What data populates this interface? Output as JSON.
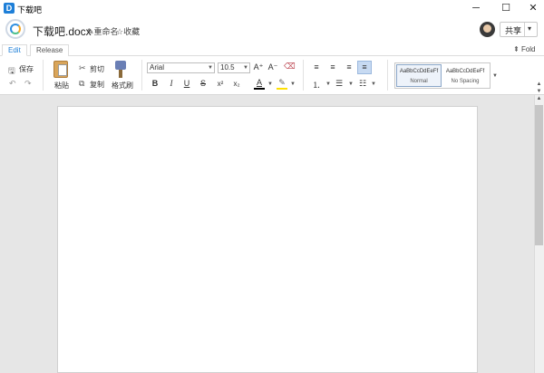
{
  "window": {
    "title": "下载吧",
    "app_icon_letter": "D",
    "minimize_glyph": "─",
    "maximize_glyph": "☐",
    "close_glyph": "✕"
  },
  "document": {
    "name": "下载吧.docx",
    "rename_label": "重命名",
    "favorite_label": "收藏",
    "share_label": "共享"
  },
  "tabs": [
    {
      "label": "Edit",
      "active": true
    },
    {
      "label": "Release",
      "active": false
    }
  ],
  "fold_label": "Fold",
  "ribbon": {
    "save_label": "保存",
    "paste_label": "粘贴",
    "cut_label": "剪切",
    "copy_label": "复制",
    "format_painter_label": "格式刷",
    "font_family": "Arial",
    "font_size": "10.5",
    "bold_glyph": "B",
    "italic_glyph": "I",
    "underline_glyph": "U",
    "strike_glyph": "S",
    "superscript_glyph": "x²",
    "subscript_glyph": "x₂",
    "font_color_glyph": "A",
    "grow_font_glyph": "A⁺",
    "shrink_font_glyph": "A⁻",
    "styles": [
      {
        "preview": "AaBbCcDdEeFf",
        "name": "Normal",
        "selected": true
      },
      {
        "preview": "AaBbCcDdEeFf",
        "name": "No Spacing",
        "selected": false
      }
    ]
  },
  "colors": {
    "accent": "#1e7fd8",
    "font_color_bar": "#000000",
    "highlight_bar": "#ffe000",
    "canvas": "#e6e6e6"
  }
}
